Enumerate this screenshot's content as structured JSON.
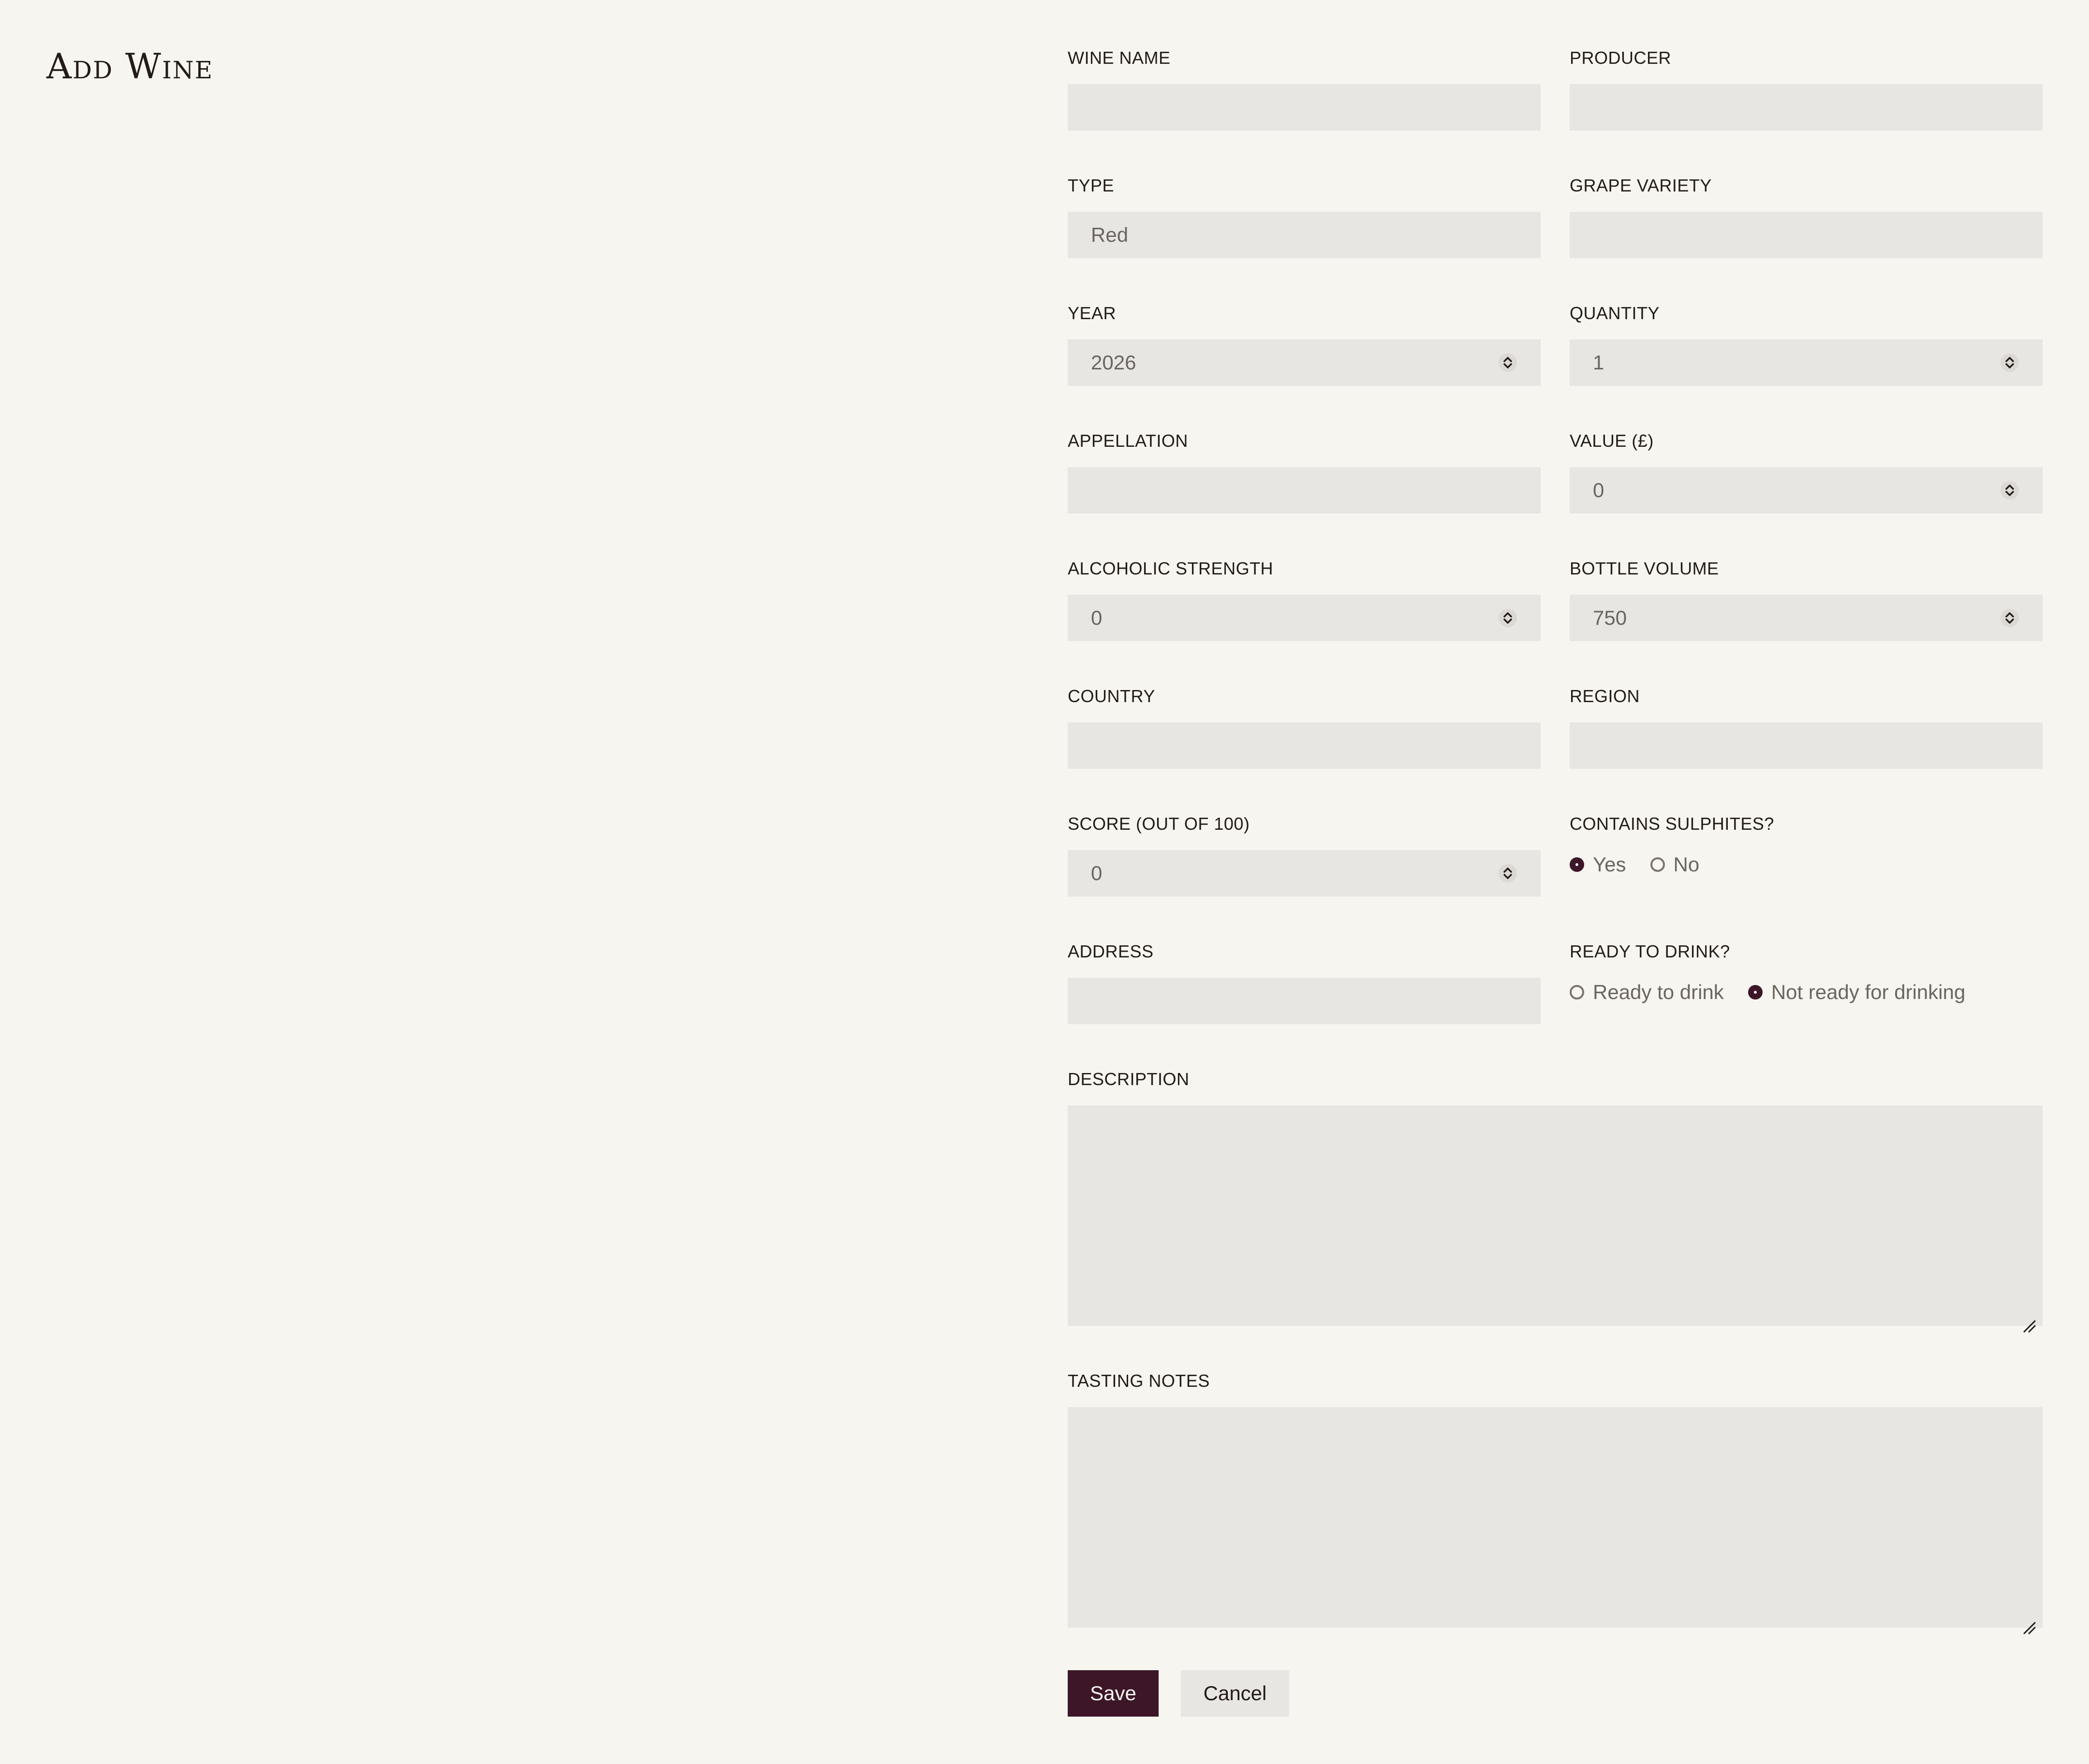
{
  "title": "Add Wine",
  "fields": {
    "wine_name": {
      "label": "WINE NAME",
      "value": ""
    },
    "producer": {
      "label": "PRODUCER",
      "value": ""
    },
    "type": {
      "label": "TYPE",
      "value": "Red"
    },
    "grape_variety": {
      "label": "GRAPE VARIETY",
      "value": ""
    },
    "year": {
      "label": "YEAR",
      "value": "2026"
    },
    "quantity": {
      "label": "QUANTITY",
      "value": "1"
    },
    "appellation": {
      "label": "APPELLATION",
      "value": ""
    },
    "value": {
      "label": "VALUE (£)",
      "value": "0"
    },
    "alcoholic_strength": {
      "label": "ALCOHOLIC STRENGTH",
      "value": "0"
    },
    "bottle_volume": {
      "label": "BOTTLE VOLUME",
      "value": "750"
    },
    "country": {
      "label": "COUNTRY",
      "value": ""
    },
    "region": {
      "label": "REGION",
      "value": ""
    },
    "score": {
      "label": "SCORE (OUT OF 100)",
      "value": "0"
    },
    "contains_sulphites": {
      "label": "CONTAINS SULPHITES?",
      "options": [
        "Yes",
        "No"
      ],
      "selected": "Yes"
    },
    "address": {
      "label": "ADDRESS",
      "value": ""
    },
    "ready_to_drink": {
      "label": "READY TO DRINK?",
      "options": [
        "Ready to drink",
        "Not ready for drinking"
      ],
      "selected": "Not ready for drinking"
    },
    "description": {
      "label": "DESCRIPTION",
      "value": ""
    },
    "tasting_notes": {
      "label": "TASTING NOTES",
      "value": ""
    }
  },
  "buttons": {
    "save_label": "Save",
    "cancel_label": "Cancel"
  },
  "icons": {
    "stepper": "stepper-updown-icon",
    "resize": "resize-handle-icon"
  },
  "colors": {
    "background": "#f6f5f0",
    "field_bg": "#e8e6e2",
    "accent": "#3d1628",
    "text": "#231b16",
    "muted_text": "#6b6560"
  }
}
